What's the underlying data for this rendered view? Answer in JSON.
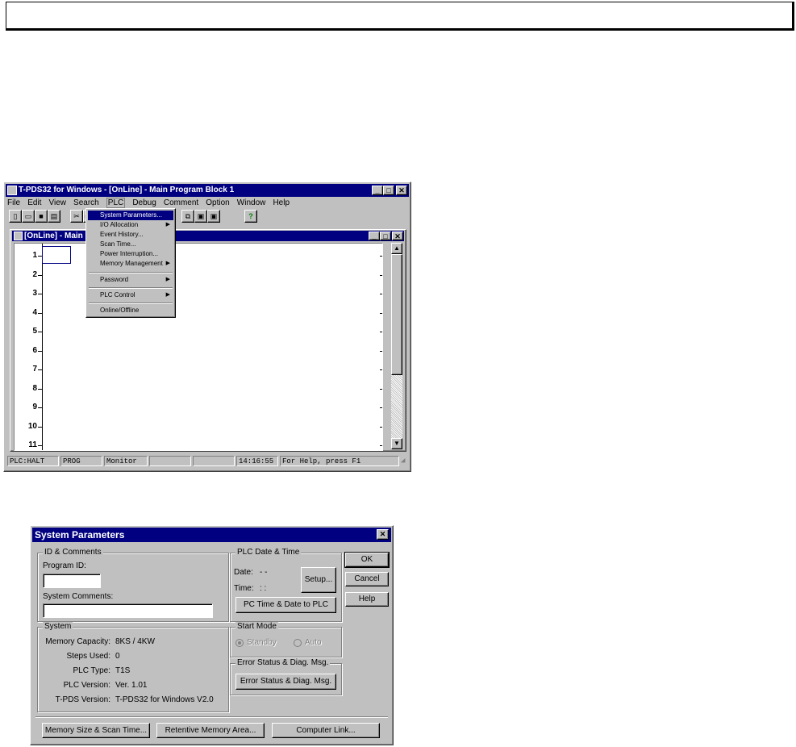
{
  "app": {
    "title": "T-PDS32 for Windows - [OnLine] - Main Program Block 1",
    "menu": [
      "File",
      "Edit",
      "View",
      "Search",
      "PLC",
      "Debug",
      "Comment",
      "Option",
      "Window",
      "Help"
    ],
    "child_title": "[OnLine] - Main Prog",
    "rows": [
      "1",
      "2",
      "3",
      "4",
      "5",
      "6",
      "7",
      "8",
      "9",
      "10",
      "11"
    ],
    "status": {
      "plc": "PLC:HALT",
      "mode": "PROG",
      "monitor": "Monitor",
      "time": "14:16:55",
      "help": "For Help, press F1"
    }
  },
  "plc_menu": {
    "items": [
      {
        "label": "System Parameters...",
        "selected": true,
        "submenu": false
      },
      {
        "label": "I/O Allocation",
        "submenu": true
      },
      {
        "label": "Event History...",
        "submenu": false
      },
      {
        "label": "Scan Time...",
        "submenu": false
      },
      {
        "label": "Power Interruption...",
        "submenu": false
      },
      {
        "label": "Memory Management",
        "submenu": true
      },
      {
        "label": "Password",
        "submenu": true
      },
      {
        "label": "PLC Control",
        "submenu": true
      },
      {
        "label": "Online/Offline",
        "submenu": false
      }
    ]
  },
  "dialog": {
    "title": "System Parameters",
    "id_group": {
      "title": "ID & Comments",
      "program_id_label": "Program ID:",
      "program_id_value": "",
      "comments_label": "System Comments:",
      "comments_value": ""
    },
    "system_group": {
      "title": "System",
      "rows": [
        {
          "label": "Memory Capacity:",
          "value": "8KS / 4KW"
        },
        {
          "label": "Steps Used:",
          "value": "0"
        },
        {
          "label": "PLC Type:",
          "value": "T1S"
        },
        {
          "label": "PLC Version:",
          "value": "Ver. 1.01"
        },
        {
          "label": "T-PDS Version:",
          "value": "T-PDS32 for Windows V2.0"
        }
      ]
    },
    "datetime_group": {
      "title": "PLC Date & Time",
      "date_label": "Date:",
      "date_value": "- -",
      "time_label": "Time:",
      "time_value": ": :",
      "setup_button": "Setup...",
      "sync_button": "PC Time & Date to PLC"
    },
    "start_mode": {
      "title": "Start Mode",
      "standby": "Standby",
      "auto": "Auto"
    },
    "error_group": {
      "title": "Error Status & Diag. Msg.",
      "button": "Error Status & Diag. Msg."
    },
    "buttons": {
      "ok": "OK",
      "cancel": "Cancel",
      "help": "Help",
      "memory": "Memory Size & Scan Time...",
      "retentive": "Retentive Memory Area...",
      "link": "Computer Link..."
    }
  }
}
